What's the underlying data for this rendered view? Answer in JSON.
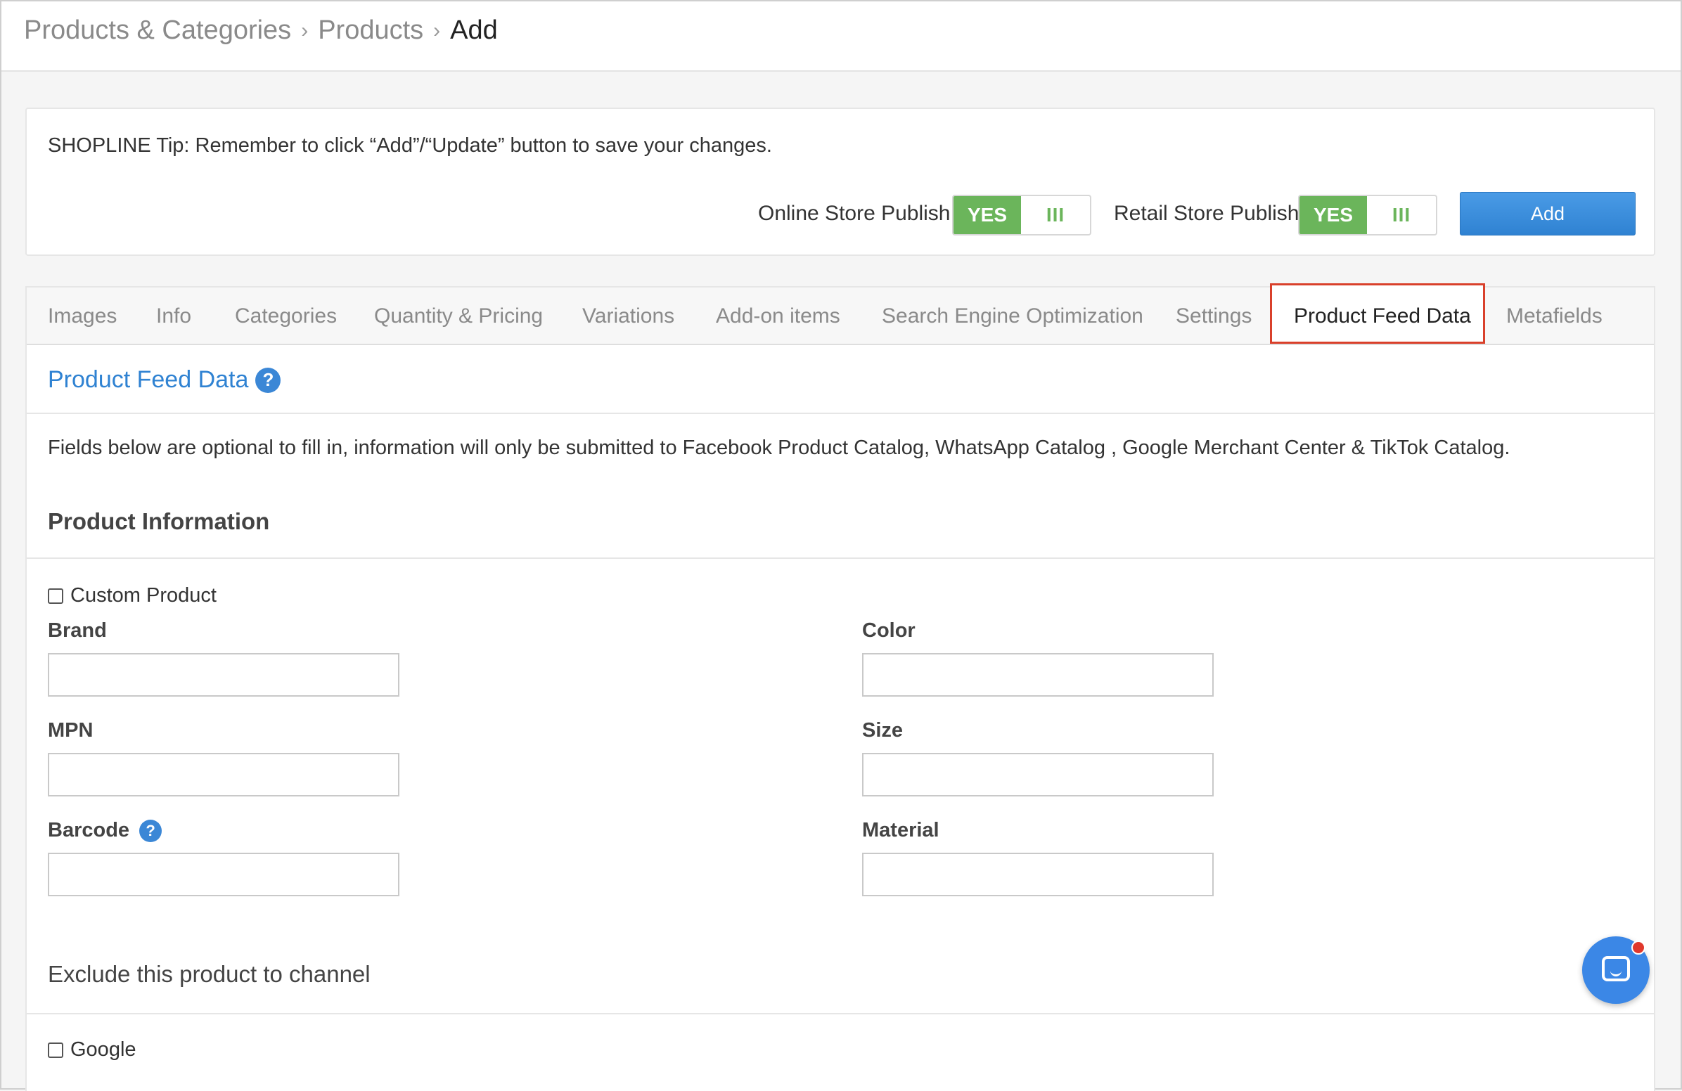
{
  "breadcrumb": {
    "items": [
      "Products & Categories",
      "Products",
      "Add"
    ]
  },
  "tip": {
    "text": "SHOPLINE Tip: Remember to click “Add”/“Update” button to save your changes."
  },
  "publish": {
    "online_label": "Online Store Publish",
    "online_value": "YES",
    "retail_label": "Retail Store Publish",
    "retail_value": "YES",
    "handle_glyph": "III",
    "add_label": "Add"
  },
  "tabs": [
    {
      "label": "Images"
    },
    {
      "label": "Info"
    },
    {
      "label": "Categories"
    },
    {
      "label": "Quantity & Pricing"
    },
    {
      "label": "Variations"
    },
    {
      "label": "Add-on items"
    },
    {
      "label": "Search Engine Optimization"
    },
    {
      "label": "Settings"
    },
    {
      "label": "Product Feed Data"
    },
    {
      "label": "Metafields"
    }
  ],
  "active_tab": "Product Feed Data",
  "section": {
    "title": "Product Feed Data",
    "help_glyph": "?",
    "description": "Fields below are optional to fill in, information will only be submitted to Facebook Product Catalog, WhatsApp Catalog , Google Merchant Center & TikTok Catalog.",
    "product_info_heading": "Product Information",
    "custom_product_label": "Custom Product",
    "fields": {
      "brand": {
        "label": "Brand",
        "value": ""
      },
      "color": {
        "label": "Color",
        "value": ""
      },
      "mpn": {
        "label": "MPN",
        "value": ""
      },
      "size": {
        "label": "Size",
        "value": ""
      },
      "barcode": {
        "label": "Barcode",
        "value": ""
      },
      "material": {
        "label": "Material",
        "value": ""
      }
    },
    "exclude_heading": "Exclude this product to channel",
    "google_label": "Google"
  },
  "colors": {
    "accent_blue": "#2f82d2",
    "toggle_green": "#6bb55b",
    "highlight_red": "#d9402b"
  }
}
